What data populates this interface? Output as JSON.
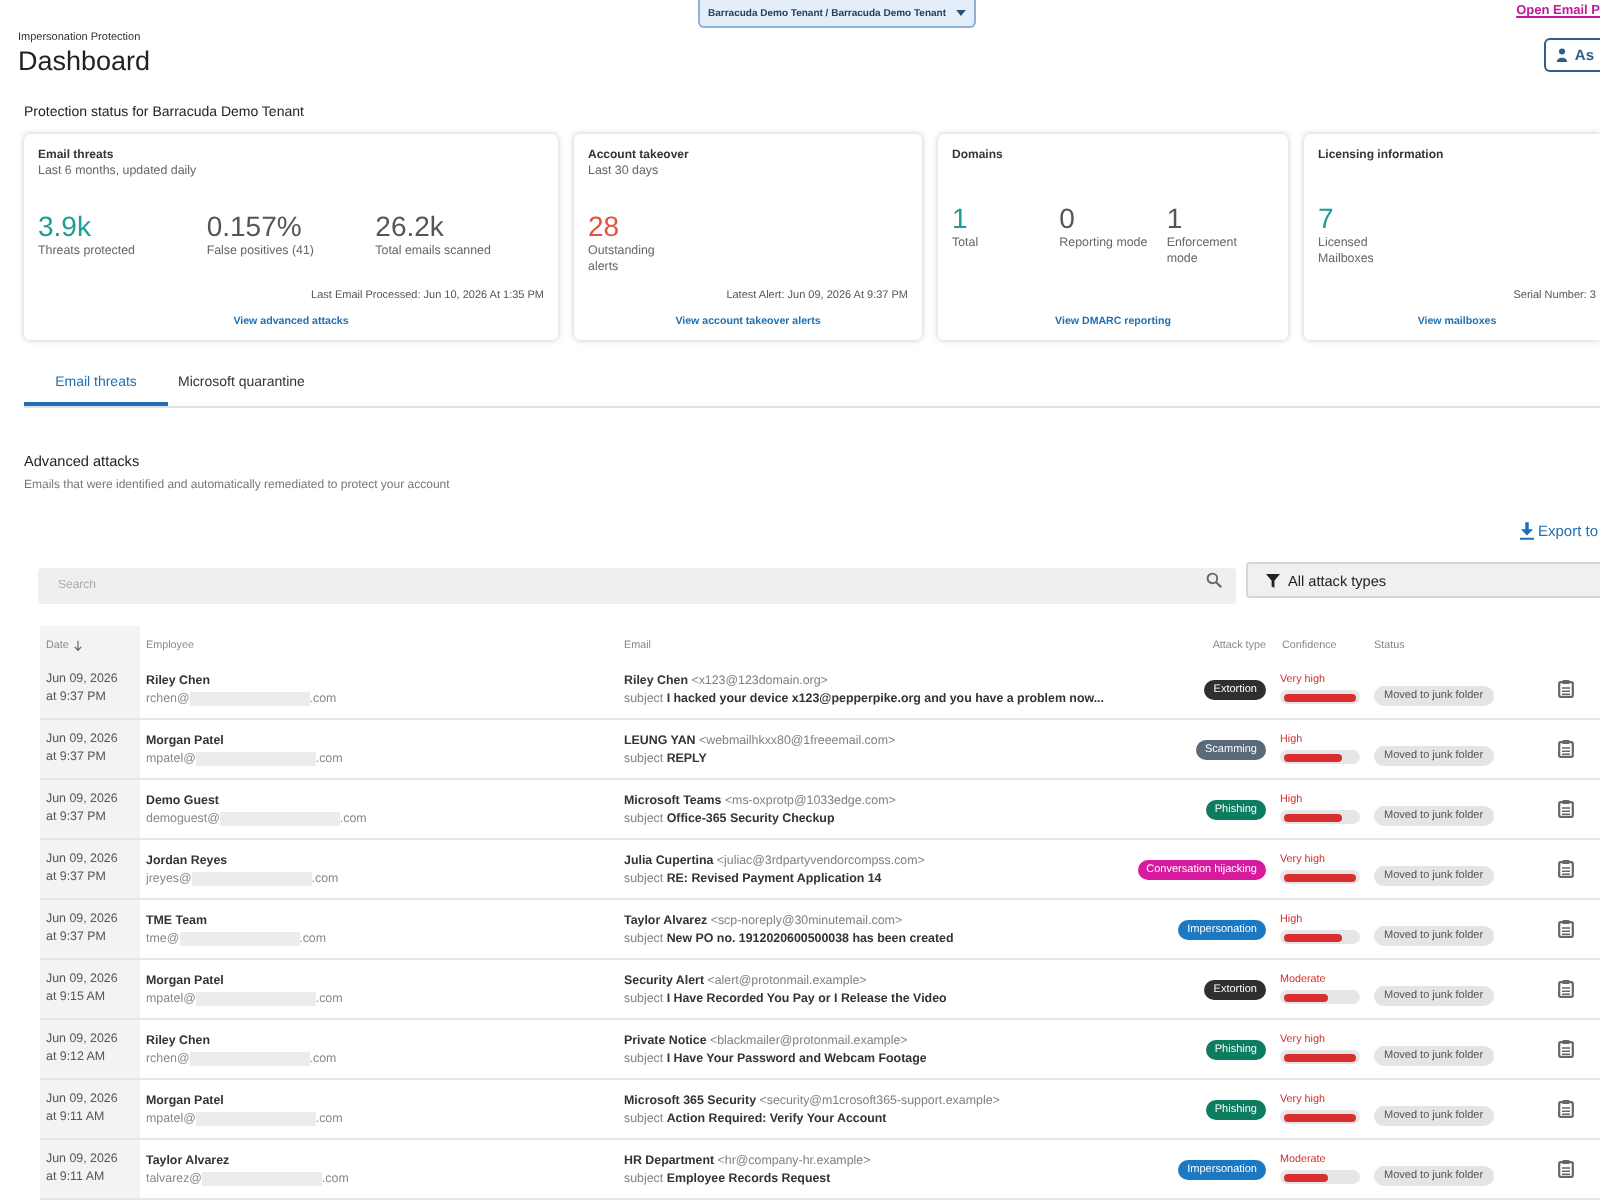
{
  "header": {
    "breadcrumb": "Impersonation Protection",
    "title": "Dashboard",
    "tenant_selector": "Barracuda Demo Tenant / Barracuda Demo Tenant",
    "top_link": "Open Email P",
    "button": "As"
  },
  "protection_status": {
    "title": "Protection status for Barracuda Demo Tenant",
    "cards": [
      {
        "title": "Email threats",
        "subtitle": "Last 6 months, updated daily",
        "stats": [
          {
            "value": "3.9k",
            "label": "Threats protected",
            "color": "#1a9e96"
          },
          {
            "value": "0.157%",
            "label": "False positives (41)",
            "color": "#555555"
          },
          {
            "value": "26.2k",
            "label": "Total emails scanned",
            "color": "#555555"
          }
        ],
        "footer": "Last Email Processed: Jun 10, 2026 At 1:35 PM",
        "link": "View advanced attacks"
      },
      {
        "title": "Account takeover",
        "subtitle": "Last 30 days",
        "stats": [
          {
            "value": "28",
            "label": "Outstanding alerts",
            "color": "#e0533d"
          }
        ],
        "footer": "Latest Alert: Jun 09, 2026 At 9:37 PM",
        "link": "View account takeover alerts"
      },
      {
        "title": "Domains",
        "stats": [
          {
            "value": "1",
            "label": "Total",
            "color": "#1a9e96"
          },
          {
            "value": "0",
            "label": "Reporting mode",
            "color": "#555555"
          },
          {
            "value": "1",
            "label": "Enforcement mode",
            "color": "#555555"
          }
        ],
        "link": "View DMARC reporting"
      },
      {
        "title": "Licensing information",
        "stats": [
          {
            "value": "7",
            "label": "Licensed Mailboxes",
            "color": "#1a9e96"
          }
        ],
        "footer": "Serial Number: 3",
        "link": "View mailboxes"
      }
    ]
  },
  "tabs": [
    {
      "label": "Email threats",
      "selected": true
    },
    {
      "label": "Microsoft quarantine",
      "selected": false
    }
  ],
  "advanced_attacks": {
    "title": "Advanced attacks",
    "description": "Emails that were identified and automatically remediated to protect your account",
    "export_button": "Export to",
    "search": {
      "placeholder": "Search"
    },
    "filter": "All attack types",
    "table": {
      "columns": [
        {
          "label": "Date",
          "sorted": true
        },
        {
          "label": "Employee",
          "sorted": false
        },
        {
          "label": "Email",
          "sorted": false
        },
        {
          "label": "Attack type",
          "sorted": false
        },
        {
          "label": "Confidence",
          "sorted": false
        },
        {
          "label": "Status",
          "sorted": false
        }
      ],
      "rows": [
        {
          "date": "Jun 09, 2026",
          "time": "at 9:37 PM",
          "employee": {
            "name": "Riley Chen",
            "email_start": "rchen@",
            "email_end": ".com"
          },
          "sender": "**Riley Chen** <x123@123domain.org>",
          "subject": "subject **I hacked your device x123@pepperpike.org and you have a problem now...**",
          "attack_type": {
            "label": "Extortion",
            "color": "#2f2f2f"
          },
          "confidence": {
            "label": "Very high",
            "level": 1
          },
          "status": "Moved to junk folder"
        },
        {
          "date": "Jun 09, 2026",
          "time": "at 9:37 PM",
          "employee": {
            "name": "Morgan Patel",
            "email_start": "mpatel@",
            "email_end": ".com"
          },
          "sender": "**LEUNG YAN** <webmailhkxx80@1freeemail.com>",
          "subject": "subject **REPLY**",
          "attack_type": {
            "label": "Scamming",
            "color": "#5a6a7a"
          },
          "confidence": {
            "label": "High",
            "level": 0.8
          },
          "status": "Moved to junk folder"
        },
        {
          "date": "Jun 09, 2026",
          "time": "at 9:37 PM",
          "employee": {
            "name": "Demo Guest",
            "email_start": "demoguest@",
            "email_end": ".com"
          },
          "sender": "**Microsoft Teams** <ms-oxprotp@1033edge.com>",
          "subject": "subject **Office-365 Security Checkup**",
          "attack_type": {
            "label": "Phishing",
            "color": "#0e7c5e"
          },
          "confidence": {
            "label": "High",
            "level": 0.8
          },
          "status": "Moved to junk folder"
        },
        {
          "date": "Jun 09, 2026",
          "time": "at 9:37 PM",
          "employee": {
            "name": "Jordan Reyes",
            "email_start": "jreyes@",
            "email_end": ".com"
          },
          "sender": "**Julia Cupertina** <juliac@3rdpartyvendorcompss.com>",
          "subject": "subject **RE: Revised Payment Application 14**",
          "attack_type": {
            "label": "Conversation hijacking",
            "color": "#d81b9e"
          },
          "confidence": {
            "label": "Very high",
            "level": 1
          },
          "status": "Moved to junk folder"
        },
        {
          "date": "Jun 09, 2026",
          "time": "at 9:37 PM",
          "employee": {
            "name": "TME Team",
            "email_start": "tme@",
            "email_end": ".com"
          },
          "sender": "**Taylor Alvarez** <scp-noreply@30minutemail.com>",
          "subject": "subject **New PO no. 1912020600500038 has been created**",
          "attack_type": {
            "label": "Impersonation",
            "color": "#1b78c2"
          },
          "confidence": {
            "label": "High",
            "level": 0.8
          },
          "status": "Moved to junk folder"
        },
        {
          "date": "Jun 09, 2026",
          "time": "at 9:15 AM",
          "employee": {
            "name": "Morgan Patel",
            "email_start": "mpatel@",
            "email_end": ".com"
          },
          "sender": "**Security Alert** <alert@protonmail.example>",
          "subject": "subject **I Have Recorded You Pay or I Release the Video**",
          "attack_type": {
            "label": "Extortion",
            "color": "#2f2f2f"
          },
          "confidence": {
            "label": "Moderate",
            "level": 0.6
          },
          "status": "Moved to junk folder"
        },
        {
          "date": "Jun 09, 2026",
          "time": "at 9:12 AM",
          "employee": {
            "name": "Riley Chen",
            "email_start": "rchen@",
            "email_end": ".com"
          },
          "sender": "**Private Notice** <blackmailer@protonmail.example>",
          "subject": "subject **I Have Your Password and Webcam Footage**",
          "attack_type": {
            "label": "Phishing",
            "color": "#0e7c5e"
          },
          "confidence": {
            "label": "Very high",
            "level": 1
          },
          "status": "Moved to junk folder"
        },
        {
          "date": "Jun 09, 2026",
          "time": "at 9:11 AM",
          "employee": {
            "name": "Morgan Patel",
            "email_start": "mpatel@",
            "email_end": ".com"
          },
          "sender": "**Microsoft 365 Security** <security@m1crosoft365-support.example>",
          "subject": "subject **Action Required: Verify Your Account**",
          "attack_type": {
            "label": "Phishing",
            "color": "#0e7c5e"
          },
          "confidence": {
            "label": "Very high",
            "level": 1
          },
          "status": "Moved to junk folder"
        },
        {
          "date": "Jun 09, 2026",
          "time": "at 9:11 AM",
          "employee": {
            "name": "Taylor Alvarez",
            "email_start": "talvarez@",
            "email_end": ".com"
          },
          "sender": "**HR Department** <hr@company-hr.example>",
          "subject": "subject **Employee Records Request**",
          "attack_type": {
            "label": "Impersonation",
            "color": "#1b78c2"
          },
          "confidence": {
            "label": "Moderate",
            "level": 0.6
          },
          "status": "Moved to junk folder"
        }
      ]
    }
  }
}
